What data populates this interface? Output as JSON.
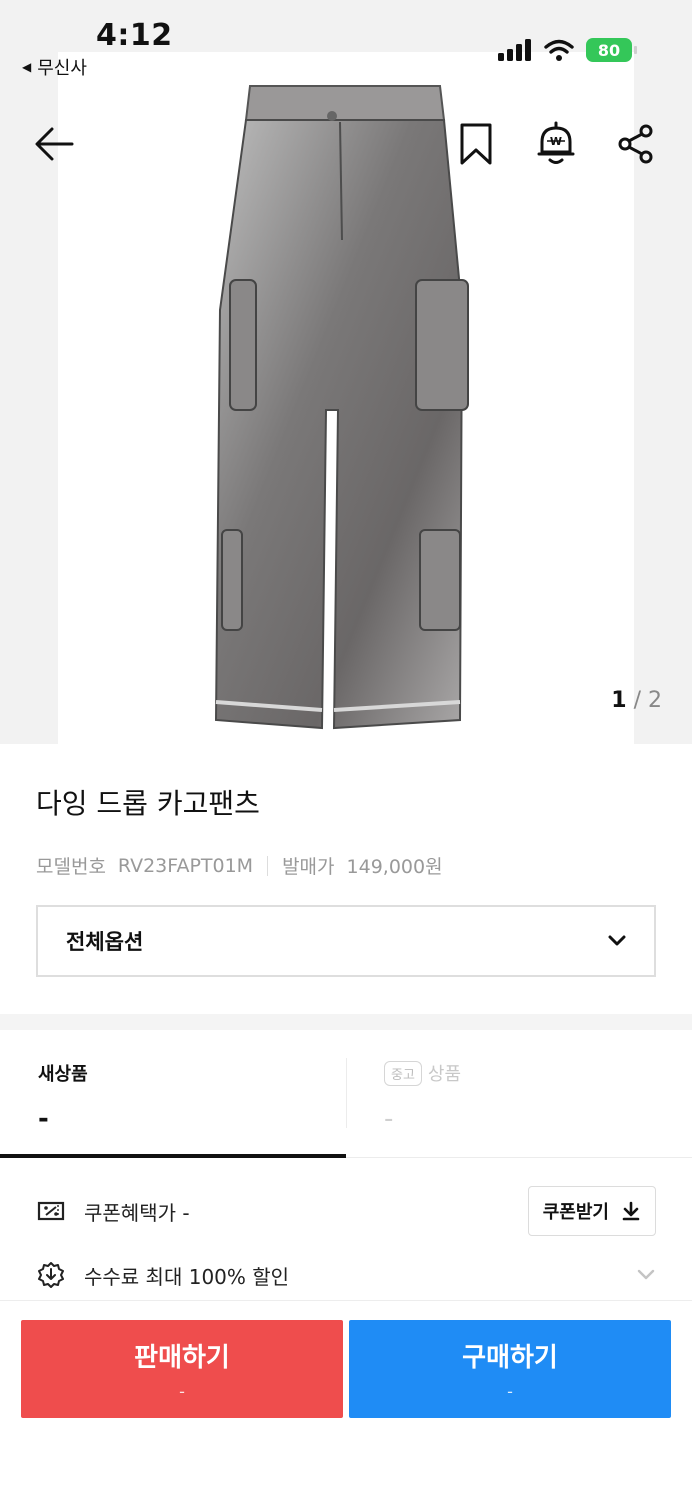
{
  "status_bar": {
    "time": "4:12",
    "back_app": "무신사",
    "battery": "80"
  },
  "header": {
    "icons": [
      "back-arrow-icon",
      "bookmark-icon",
      "price-alert-bell-icon",
      "share-icon"
    ]
  },
  "gallery": {
    "current": "1",
    "separator": "/",
    "total": "2"
  },
  "product": {
    "title": "다잉 드롭 카고팬츠",
    "model_label": "모델번호",
    "model_value": "RV23FAPT01M",
    "release_label": "발매가",
    "release_value": "149,000원"
  },
  "options": {
    "selected": "전체옵션"
  },
  "tabs": {
    "new": {
      "label": "새상품",
      "price": "-"
    },
    "used": {
      "chip": "중고",
      "label": "상품",
      "price": "-"
    }
  },
  "benefits": {
    "coupon_text": "쿠폰혜택가 -",
    "coupon_button": "쿠폰받기",
    "fee_text": "수수료 최대 100% 할인"
  },
  "actions": {
    "sell": {
      "label": "판매하기",
      "sub": "-"
    },
    "buy": {
      "label": "구매하기",
      "sub": "-"
    }
  },
  "colors": {
    "sell": "#ef4d4d",
    "buy": "#1f8cf5",
    "battery": "#34c759"
  }
}
